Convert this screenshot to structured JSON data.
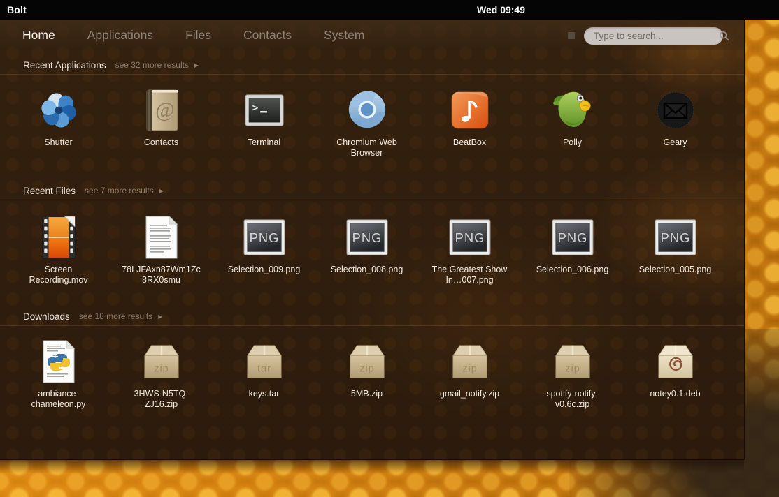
{
  "topbar": {
    "title": "Bolt",
    "clock": "Wed 09:49"
  },
  "tabs": [
    {
      "label": "Home",
      "active": true
    },
    {
      "label": "Applications",
      "active": false
    },
    {
      "label": "Files",
      "active": false
    },
    {
      "label": "Contacts",
      "active": false
    },
    {
      "label": "System",
      "active": false
    }
  ],
  "search": {
    "placeholder": "Type to search..."
  },
  "ui": {
    "more_arrow": "▶"
  },
  "colors": {
    "topbar_bg": "#050505",
    "panel_bg": "#2f1d0e",
    "wallpaper_orange": "#cb7b0d",
    "active_tab_text": "#f6f3ee",
    "inactive_tab_text": "#8d8478",
    "label_text": "#f2ecdf",
    "section_more_text": "#8c7c6a"
  },
  "sections": [
    {
      "title": "Recent Applications",
      "more_label": "see 32 more results",
      "items": [
        {
          "label": "Shutter",
          "icon": "shutter"
        },
        {
          "label": "Contacts",
          "icon": "address-book"
        },
        {
          "label": "Terminal",
          "icon": "terminal"
        },
        {
          "label": "Chromium Web Browser",
          "icon": "chromium"
        },
        {
          "label": "BeatBox",
          "icon": "beatbox-music-note"
        },
        {
          "label": "Polly",
          "icon": "polly-parrot"
        },
        {
          "label": "Geary",
          "icon": "geary-envelope"
        }
      ]
    },
    {
      "title": "Recent Files",
      "more_label": "see 7 more results",
      "items": [
        {
          "label": "Screen Recording.mov",
          "icon": "video-film"
        },
        {
          "label": "78LJFAxn87Wm1Zc8RX0smu",
          "icon": "text-document"
        },
        {
          "label": "Selection_009.png",
          "icon": "png-image"
        },
        {
          "label": "Selection_008.png",
          "icon": "png-image"
        },
        {
          "label": "The Greatest Show In…007.png",
          "icon": "png-image"
        },
        {
          "label": "Selection_006.png",
          "icon": "png-image"
        },
        {
          "label": "Selection_005.png",
          "icon": "png-image"
        }
      ]
    },
    {
      "title": "Downloads",
      "more_label": "see 18 more results",
      "items": [
        {
          "label": "ambiance-chameleon.py",
          "icon": "python-script"
        },
        {
          "label": "3HWS-N5TQ-ZJ16.zip",
          "icon": "zip-archive"
        },
        {
          "label": "keys.tar",
          "icon": "tar-archive"
        },
        {
          "label": "5MB.zip",
          "icon": "zip-archive"
        },
        {
          "label": "gmail_notify.zip",
          "icon": "zip-archive"
        },
        {
          "label": "spotify-notify-v0.6c.zip",
          "icon": "zip-archive"
        },
        {
          "label": "notey0.1.deb",
          "icon": "deb-package"
        }
      ]
    }
  ]
}
